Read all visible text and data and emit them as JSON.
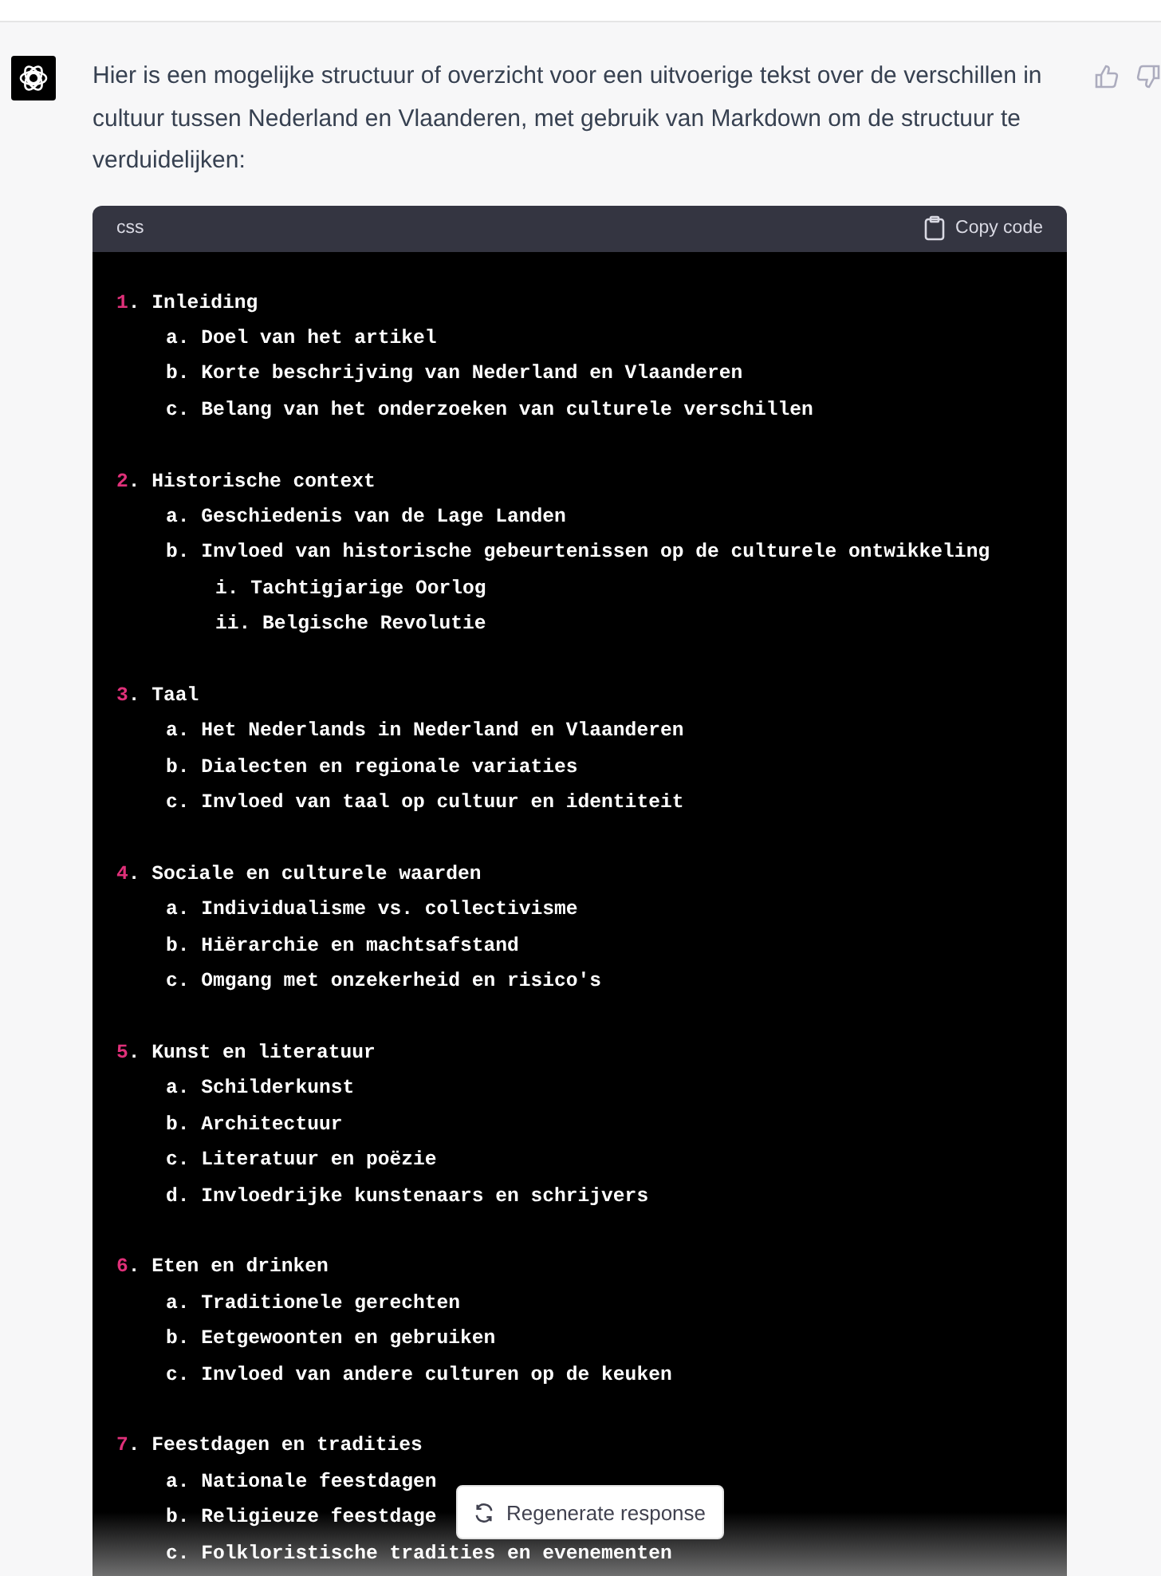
{
  "message": {
    "text": "Hier is een mogelijke structuur of overzicht voor een uitvoerige tekst over de verschillen in cultuur tussen Nederland en Vlaanderen, met gebruik van Markdown om de structuur te verduidelijken:"
  },
  "code_block": {
    "language": "css",
    "copy_label": "Copy code",
    "sections": [
      {
        "marker": "1.",
        "text": "Inleiding",
        "children": [
          {
            "marker": "a.",
            "text": "Doel van het artikel"
          },
          {
            "marker": "b.",
            "text": "Korte beschrijving van Nederland en Vlaanderen"
          },
          {
            "marker": "c.",
            "text": "Belang van het onderzoeken van culturele verschillen"
          }
        ]
      },
      {
        "marker": "2.",
        "text": "Historische context",
        "children": [
          {
            "marker": "a.",
            "text": "Geschiedenis van de Lage Landen"
          },
          {
            "marker": "b.",
            "text": "Invloed van historische gebeurtenissen op de culturele ontwikkeling",
            "children": [
              {
                "marker": "i.",
                "text": "Tachtigjarige Oorlog"
              },
              {
                "marker": "ii.",
                "text": "Belgische Revolutie"
              }
            ]
          }
        ]
      },
      {
        "marker": "3.",
        "text": "Taal",
        "children": [
          {
            "marker": "a.",
            "text": "Het Nederlands in Nederland en Vlaanderen"
          },
          {
            "marker": "b.",
            "text": "Dialecten en regionale variaties"
          },
          {
            "marker": "c.",
            "text": "Invloed van taal op cultuur en identiteit"
          }
        ]
      },
      {
        "marker": "4.",
        "text": "Sociale en culturele waarden",
        "children": [
          {
            "marker": "a.",
            "text": "Individualisme vs. collectivisme"
          },
          {
            "marker": "b.",
            "text": "Hiërarchie en machtsafstand"
          },
          {
            "marker": "c.",
            "text": "Omgang met onzekerheid en risico's"
          }
        ]
      },
      {
        "marker": "5.",
        "text": "Kunst en literatuur",
        "children": [
          {
            "marker": "a.",
            "text": "Schilderkunst"
          },
          {
            "marker": "b.",
            "text": "Architectuur"
          },
          {
            "marker": "c.",
            "text": "Literatuur en poëzie"
          },
          {
            "marker": "d.",
            "text": "Invloedrijke kunstenaars en schrijvers"
          }
        ]
      },
      {
        "marker": "6.",
        "text": "Eten en drinken",
        "children": [
          {
            "marker": "a.",
            "text": "Traditionele gerechten"
          },
          {
            "marker": "b.",
            "text": "Eetgewoonten en gebruiken"
          },
          {
            "marker": "c.",
            "text": "Invloed van andere culturen op de keuken"
          }
        ]
      },
      {
        "marker": "7.",
        "text": "Feestdagen en tradities",
        "children": [
          {
            "marker": "a.",
            "text": "Nationale feestdagen"
          },
          {
            "marker": "b.",
            "text": "Religieuze feestdage"
          },
          {
            "marker": "c.",
            "text": "Folkloristische tradities en evenementen"
          }
        ]
      }
    ]
  },
  "regenerate_button": {
    "label": "Regenerate response"
  }
}
